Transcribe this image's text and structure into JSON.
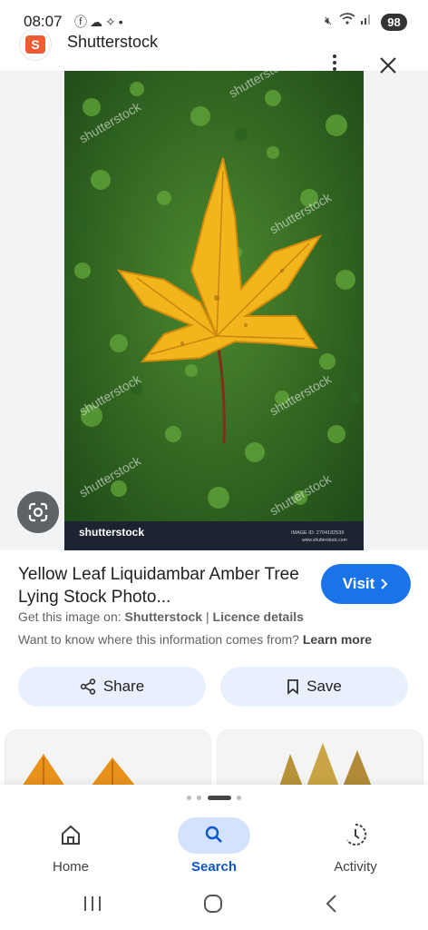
{
  "status_bar": {
    "time": "08:07",
    "left_icons": [
      "facebook-icon",
      "cloud-icon",
      "sparkle-search-icon",
      "dot"
    ],
    "right_icons": [
      "mute-icon",
      "wifi-icon",
      "signal-icon"
    ],
    "battery": "98"
  },
  "header": {
    "site_name": "Shutterstock",
    "logo_letter": "S"
  },
  "image": {
    "watermark_brand": "shutterstock",
    "image_id_text": "IMAGE ID: 2704182539",
    "site_url_text": "www.shutterstock.com",
    "watermark_text": "shutterstock"
  },
  "result": {
    "title": "Yellow Leaf Liquidambar Amber Tree Lying Stock Photo...",
    "visit_label": "Visit",
    "source_prefix": "Get this image on:",
    "source_name": "Shutterstock",
    "separator": "|",
    "licence_label": "Licence details",
    "info_question": "Want to know where this information comes from?",
    "learn_more": "Learn more"
  },
  "actions": {
    "share_label": "Share",
    "save_label": "Save"
  },
  "bottom_nav": {
    "items": [
      {
        "label": "Home",
        "icon": "home-icon"
      },
      {
        "label": "Search",
        "icon": "search-icon"
      },
      {
        "label": "Activity",
        "icon": "activity-icon"
      }
    ]
  },
  "colors": {
    "accent": "#1a73e8",
    "pill_bg": "#e8f0fe",
    "selected_nav_bg": "#d3e3fd",
    "logo": "#ef5a33"
  }
}
